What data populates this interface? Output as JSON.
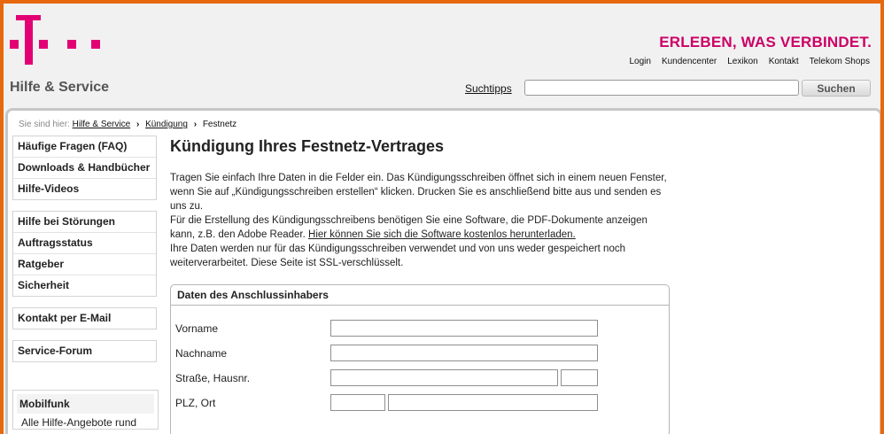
{
  "header": {
    "slogan": "ERLEBEN, WAS VERBINDET.",
    "top_links": [
      "Login",
      "Kundencenter",
      "Lexikon",
      "Kontakt",
      "Telekom Shops"
    ],
    "site_title": "Hilfe & Service",
    "search": {
      "tips_label": "Suchtipps",
      "value": "",
      "button_label": "Suchen"
    }
  },
  "breadcrumb": {
    "prefix": "Sie sind hier:",
    "items": [
      "Hilfe & Service",
      "Kündigung"
    ],
    "current": "Festnetz"
  },
  "sidebar": {
    "groups": [
      [
        "Häufige Fragen (FAQ)",
        "Downloads & Handbücher",
        "Hilfe-Videos"
      ],
      [
        "Hilfe bei Störungen",
        "Auftragsstatus",
        "Ratgeber",
        "Sicherheit"
      ],
      [
        "Kontakt per E-Mail"
      ],
      [
        "Service-Forum"
      ]
    ],
    "mobil": {
      "heading": "Mobilfunk",
      "link": "Alle Hilfe-Angebote rund"
    }
  },
  "main": {
    "title": "Kündigung Ihres Festnetz-Vertrages",
    "intro_1": "Tragen Sie einfach Ihre Daten in die Felder ein. Das Kündigungsschreiben öffnet sich in einem neuen Fenster, wenn Sie auf „Kündigungsschreiben erstellen“ klicken. Drucken Sie es anschließend bitte aus und senden es uns zu.",
    "intro_2": "Für die Erstellung des Kündigungsschreibens benötigen Sie eine Software, die PDF-Dokumente anzeigen kann, z.B. den Adobe Reader.",
    "download_link": "Hier können Sie sich die Software kostenlos herunterladen.",
    "intro_3": "Ihre Daten werden nur für das Kündigungsschreiben verwendet und von uns weder gespeichert noch weiterverarbeitet. Diese Seite ist SSL-verschlüsselt."
  },
  "form": {
    "heading": "Daten des Anschlussinhabers",
    "fields": {
      "vorname": {
        "label": "Vorname",
        "value": ""
      },
      "nachname": {
        "label": "Nachname",
        "value": ""
      },
      "strasse": {
        "label": "Straße, Hausnr.",
        "value": "",
        "hausnr": ""
      },
      "plz_ort": {
        "label": "PLZ, Ort",
        "plz": "",
        "ort": ""
      }
    }
  },
  "colors": {
    "brand_magenta": "#e20074",
    "slogan": "#cc0066",
    "border_orange": "#e8680e"
  },
  "icons": {
    "logo": "telekom-t-logo",
    "breadcrumb_separator": "chevron-right-icon"
  }
}
